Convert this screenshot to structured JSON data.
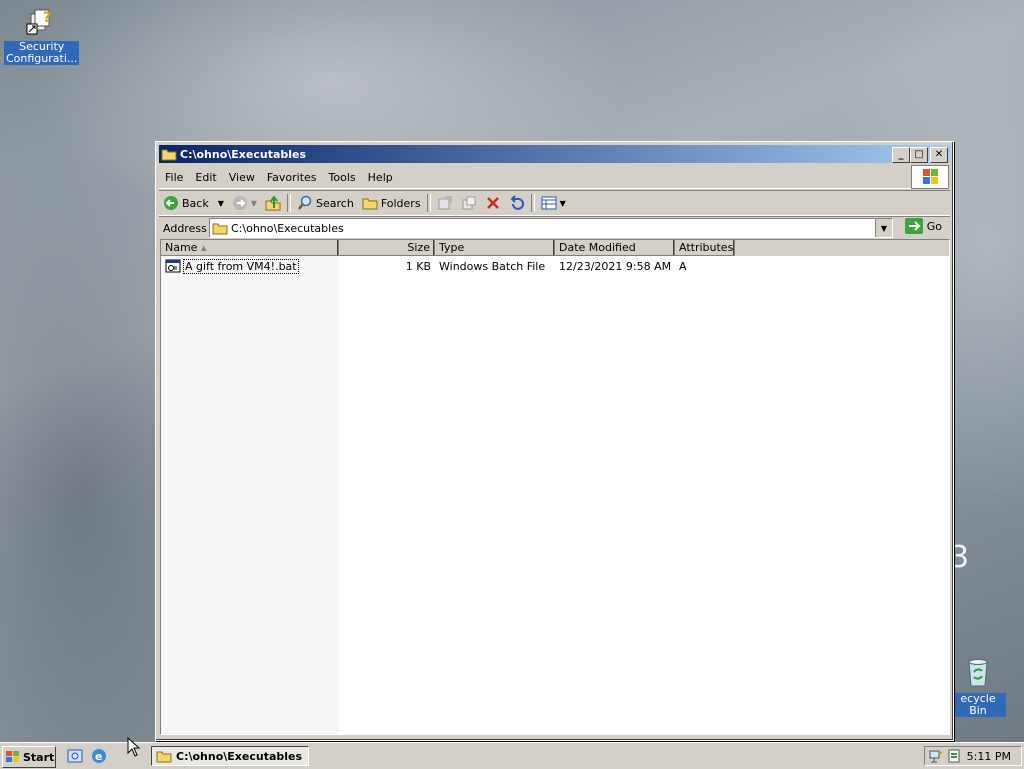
{
  "desktop": {
    "icons": [
      {
        "label": "Security Configurati..."
      },
      {
        "label": "ecycle Bin"
      }
    ],
    "watermark": "3"
  },
  "window": {
    "title": "C:\\ohno\\Executables",
    "controls": {
      "minimize": "_",
      "maximize": "□",
      "close": "✕"
    },
    "menu": [
      "File",
      "Edit",
      "View",
      "Favorites",
      "Tools",
      "Help"
    ],
    "toolbar": {
      "back": "Back",
      "search": "Search",
      "folders": "Folders"
    },
    "address": {
      "label": "Address",
      "value": "C:\\ohno\\Executables",
      "go": "Go"
    },
    "columns": [
      "Name",
      "Size",
      "Type",
      "Date Modified",
      "Attributes"
    ],
    "files": [
      {
        "name": "A gift from VM4!.bat",
        "size": "1 KB",
        "type": "Windows Batch File",
        "modified": "12/23/2021 9:58 AM",
        "attributes": "A"
      }
    ]
  },
  "taskbar": {
    "start": "Start",
    "task": "C:\\ohno\\Executables",
    "clock": "5:11 PM"
  }
}
